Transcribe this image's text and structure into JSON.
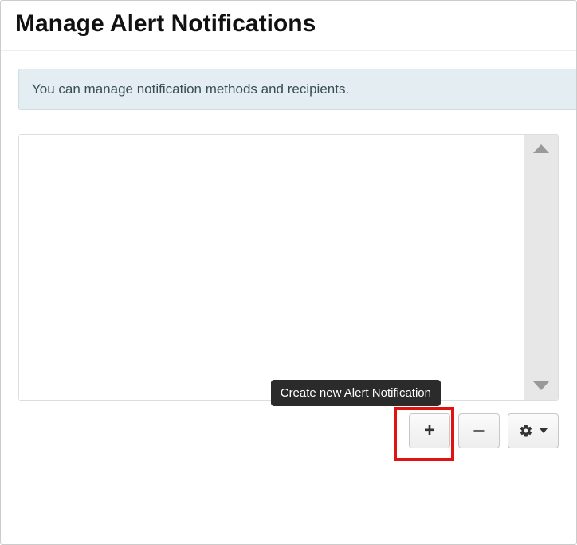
{
  "header": {
    "title": "Manage Alert Notifications"
  },
  "info": {
    "message": "You can manage notification methods and recipients."
  },
  "toolbar": {
    "add_tooltip": "Create new Alert Notification"
  }
}
